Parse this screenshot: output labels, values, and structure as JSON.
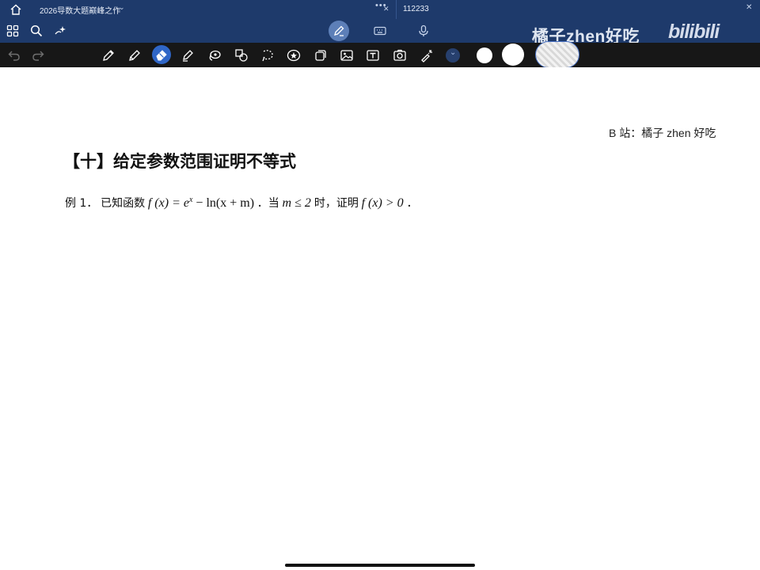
{
  "tabs": [
    {
      "label": "2026导数大题巅峰之作",
      "active": true
    },
    {
      "label": "112233",
      "active": false
    }
  ],
  "toolbar": {
    "icons": [
      "home-icon",
      "grid-icon",
      "search-icon",
      "sparkle-icon",
      "pen-mode-icon",
      "keyboard-icon",
      "microphone-icon",
      "add-page-icon",
      "export-icon",
      "more-icon"
    ]
  },
  "pen_tools": [
    "undo-icon",
    "redo-icon",
    "pen-icon",
    "pencil-icon",
    "eraser-icon",
    "highlighter-icon",
    "lasso-icon",
    "shapes-icon",
    "select-icon",
    "star-icon",
    "sticker-icon",
    "image-icon",
    "text-icon",
    "camera-icon",
    "laser-pointer-icon",
    "expand-icon"
  ],
  "watermark": {
    "channel": "橘子zhen好吃",
    "logo": "bilibili"
  },
  "colors": {
    "tabbar": "#1e3a6b",
    "penbar": "#171717",
    "accent": "#2f66c7"
  },
  "document": {
    "credit": "B 站：橘子 zhen 好吃",
    "heading": "【十】给定参数范围证明不等式",
    "problem": {
      "number": "例 1．",
      "text1": "已知函数",
      "expr1": "f (x) = e",
      "exp": "x",
      "expr2": " − ln(x + m)",
      "text2": "．当",
      "cond": " m ≤ 2 ",
      "text3": "时，证明",
      "expr3": " f (x) > 0 ",
      "text4": "．"
    }
  }
}
